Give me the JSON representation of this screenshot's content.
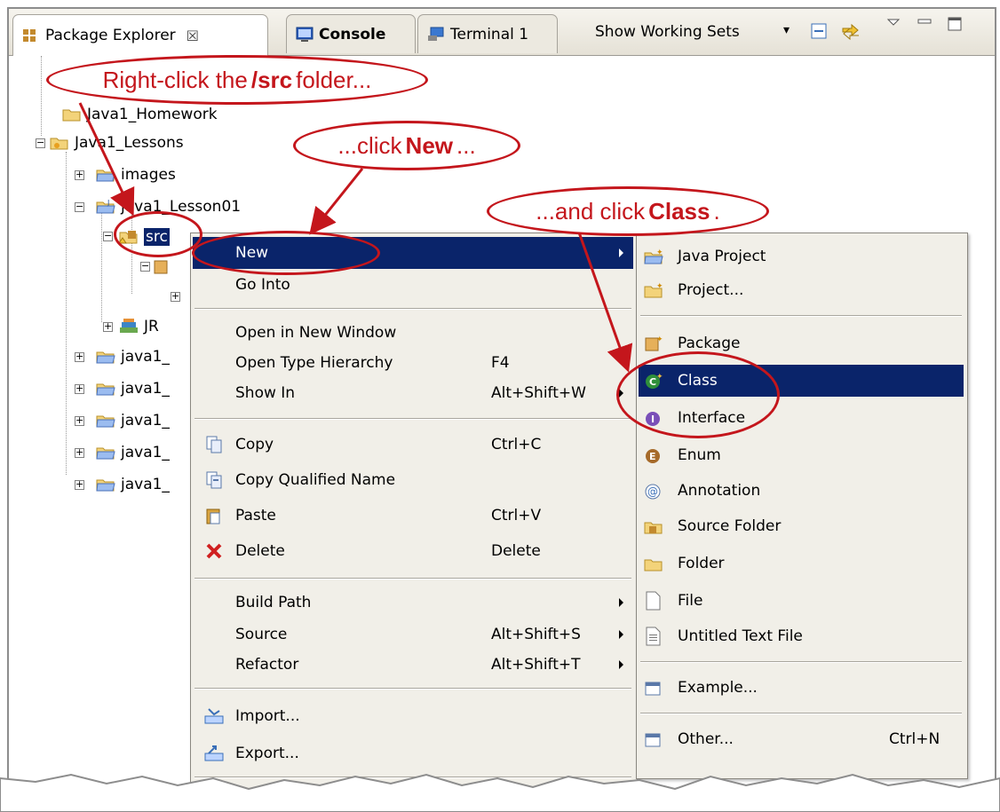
{
  "tabs": [
    {
      "label": "Package Explorer",
      "close": "☒",
      "icon": "package-icon"
    },
    {
      "label": "Console",
      "icon": "console-icon"
    },
    {
      "label": "Terminal 1",
      "icon": "terminal-icon"
    }
  ],
  "toolbar": {
    "show_working_sets": "Show Working Sets",
    "dropdown": "▾"
  },
  "tree": {
    "homework": "Java1_Homework",
    "lessons": "Java1_Lessons",
    "images": "images",
    "lesson01": "java1_Lesson01",
    "src": "src",
    "jre": "JR",
    "more_item": "java1_"
  },
  "context_menu": {
    "items": [
      {
        "label": "New",
        "accel": ""
      },
      {
        "label": "Go Into",
        "accel": ""
      },
      {
        "label": "Open in New Window",
        "accel": ""
      },
      {
        "label": "Open Type Hierarchy",
        "accel": "F4"
      },
      {
        "label": "Show In",
        "accel": "Alt+Shift+W"
      },
      {
        "label": "Copy",
        "accel": "Ctrl+C"
      },
      {
        "label": "Copy Qualified Name",
        "accel": ""
      },
      {
        "label": "Paste",
        "accel": "Ctrl+V"
      },
      {
        "label": "Delete",
        "accel": "Delete"
      },
      {
        "label": "Build Path",
        "accel": ""
      },
      {
        "label": "Source",
        "accel": "Alt+Shift+S"
      },
      {
        "label": "Refactor",
        "accel": "Alt+Shift+T"
      },
      {
        "label": "Import...",
        "accel": ""
      },
      {
        "label": "Export...",
        "accel": ""
      }
    ]
  },
  "submenu": {
    "items": [
      {
        "label": "Java Project",
        "accel": ""
      },
      {
        "label": "Project...",
        "accel": ""
      },
      {
        "label": "Package",
        "accel": ""
      },
      {
        "label": "Class",
        "accel": ""
      },
      {
        "label": "Interface",
        "accel": ""
      },
      {
        "label": "Enum",
        "accel": ""
      },
      {
        "label": "Annotation",
        "accel": ""
      },
      {
        "label": "Source Folder",
        "accel": ""
      },
      {
        "label": "Folder",
        "accel": ""
      },
      {
        "label": "File",
        "accel": ""
      },
      {
        "label": "Untitled Text File",
        "accel": ""
      },
      {
        "label": "Example...",
        "accel": ""
      },
      {
        "label": "Other...",
        "accel": "Ctrl+N"
      }
    ]
  },
  "callouts": {
    "c1_pre": "Right-click the ",
    "c1_bold": "/src",
    "c1_post": " folder...",
    "c2_pre": "...click ",
    "c2_bold": "New",
    "c2_post": "...",
    "c3_pre": "...and click ",
    "c3_bold": "Class",
    "c3_post": "."
  },
  "colors": {
    "callout_red": "#c4161c",
    "selection": "#0a246a",
    "menu_bg": "#f1efe8"
  }
}
